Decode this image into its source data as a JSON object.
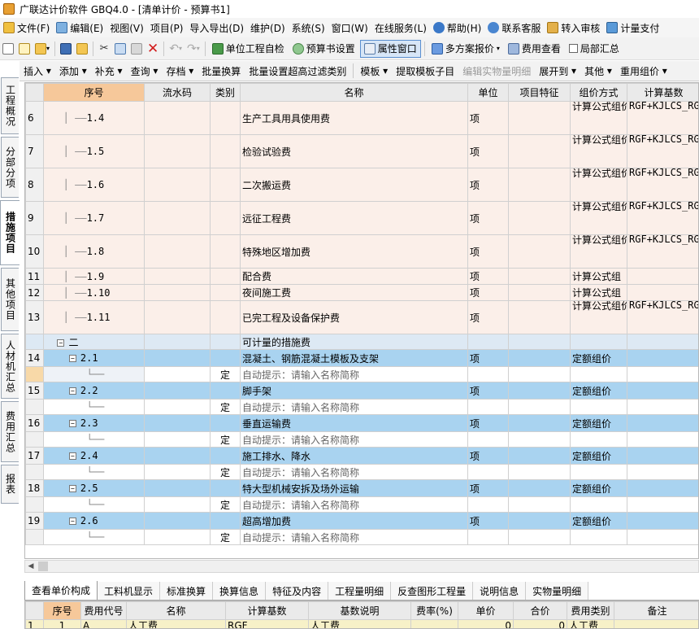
{
  "window": {
    "title": "广联达计价软件 GBQ4.0 - [清单计价 - 预算书1]"
  },
  "menu": [
    {
      "label": "文件(F)",
      "icon": "file-menu-icon"
    },
    {
      "label": "编辑(E)",
      "icon": "edit-menu-icon"
    },
    {
      "label": "视图(V)"
    },
    {
      "label": "项目(P)"
    },
    {
      "label": "导入导出(D)"
    },
    {
      "label": "维护(D)"
    },
    {
      "label": "系统(S)"
    },
    {
      "label": "窗口(W)"
    },
    {
      "label": "在线服务(L)"
    },
    {
      "label": "帮助(H)",
      "icon": "help-icon"
    },
    {
      "label": "联系客服",
      "icon": "customer-service-icon"
    },
    {
      "label": "转入审核",
      "icon": "transfer-audit-icon"
    },
    {
      "label": "计量支付",
      "icon": "measurement-payment-icon"
    }
  ],
  "toolbar1": {
    "self_check": "单位工程自检",
    "budget_settings": "预算书设置",
    "property_window": "属性窗口",
    "multi_quote": "多方案报价",
    "cost_view": "费用查看",
    "partial_summary": "局部汇总"
  },
  "toolbar2": [
    {
      "label": "插入",
      "dropdown": true
    },
    {
      "label": "添加",
      "dropdown": true
    },
    {
      "label": "补充",
      "dropdown": true
    },
    {
      "label": "查询",
      "dropdown": true
    },
    {
      "label": "存档",
      "dropdown": true
    },
    {
      "label": "批量换算",
      "dropdown": false
    },
    {
      "label": "批量设置超高过滤类别",
      "dropdown": false
    },
    {
      "label": "模板",
      "dropdown": true
    },
    {
      "label": "提取模板子目",
      "dropdown": false
    },
    {
      "label": "编辑实物量明细",
      "dropdown": false,
      "disabled": true
    },
    {
      "label": "展开到",
      "dropdown": true
    },
    {
      "label": "其他",
      "dropdown": true
    },
    {
      "label": "重用组价",
      "dropdown": true
    }
  ],
  "vtabs": [
    "工程概况",
    "分部分项",
    "措施项目",
    "其他项目",
    "人材机汇总",
    "费用汇总",
    "报表"
  ],
  "grid": {
    "headers": [
      "序号",
      "流水码",
      "类别",
      "名称",
      "单位",
      "项目特征",
      "组价方式",
      "计算基数"
    ],
    "formula_text": "RGF+KJLCS_RGF+KJLCS_JXF+JXF",
    "rows": [
      {
        "rn": "6",
        "type": "measure",
        "seq": "1.4",
        "cat": "",
        "name": "生产工具用具使用费",
        "unit": "项",
        "price": "计算公式组价",
        "formula": true
      },
      {
        "rn": "7",
        "type": "measure",
        "seq": "1.5",
        "cat": "",
        "name": "检验试验费",
        "unit": "项",
        "price": "计算公式组价",
        "formula": true
      },
      {
        "rn": "8",
        "type": "measure",
        "seq": "1.6",
        "cat": "",
        "name": "二次搬运费",
        "unit": "项",
        "price": "计算公式组价",
        "formula": true
      },
      {
        "rn": "9",
        "type": "measure",
        "seq": "1.7",
        "cat": "",
        "name": "远征工程费",
        "unit": "项",
        "price": "计算公式组价",
        "formula": true
      },
      {
        "rn": "10",
        "type": "measure",
        "seq": "1.8",
        "cat": "",
        "name": "特殊地区增加费",
        "unit": "项",
        "price": "计算公式组价",
        "formula": true
      },
      {
        "rn": "11",
        "type": "measure-short",
        "seq": "1.9",
        "cat": "",
        "name": "配合费",
        "unit": "项",
        "price": "计算公式组",
        "formula": false
      },
      {
        "rn": "12",
        "type": "measure-short",
        "seq": "1.10",
        "cat": "",
        "name": "夜间施工费",
        "unit": "项",
        "price": "计算公式组",
        "formula": false
      },
      {
        "rn": "13",
        "type": "measure",
        "seq": "1.11",
        "cat": "",
        "name": "已完工程及设备保护费",
        "unit": "项",
        "price": "计算公式组价",
        "formula": true
      },
      {
        "rn": "",
        "type": "cat",
        "seq": "二",
        "cat": "",
        "name": "可计量的措施费",
        "unit": "",
        "price": "",
        "formula": false
      },
      {
        "rn": "14",
        "type": "item",
        "seq": "2.1",
        "cat": "",
        "name": "混凝土、钢筋混凝土模板及支架",
        "unit": "项",
        "price": "定额组价",
        "formula": false
      },
      {
        "rn": "",
        "type": "sub",
        "sel": true,
        "seq": "",
        "cat": "定",
        "name": "自动提示：请输入名称简称",
        "unit": "",
        "price": "",
        "formula": false
      },
      {
        "rn": "15",
        "type": "item",
        "seq": "2.2",
        "cat": "",
        "name": "脚手架",
        "unit": "项",
        "price": "定额组价",
        "formula": false
      },
      {
        "rn": "",
        "type": "sub",
        "seq": "",
        "cat": "定",
        "name": "自动提示：请输入名称简称",
        "unit": "",
        "price": "",
        "formula": false
      },
      {
        "rn": "16",
        "type": "item",
        "seq": "2.3",
        "cat": "",
        "name": "垂直运输费",
        "unit": "项",
        "price": "定额组价",
        "formula": false
      },
      {
        "rn": "",
        "type": "sub",
        "seq": "",
        "cat": "定",
        "name": "自动提示：请输入名称简称",
        "unit": "",
        "price": "",
        "formula": false
      },
      {
        "rn": "17",
        "type": "item",
        "seq": "2.4",
        "cat": "",
        "name": "施工排水、降水",
        "unit": "项",
        "price": "定额组价",
        "formula": false
      },
      {
        "rn": "",
        "type": "sub",
        "seq": "",
        "cat": "定",
        "name": "自动提示：请输入名称简称",
        "unit": "",
        "price": "",
        "formula": false
      },
      {
        "rn": "18",
        "type": "item",
        "seq": "2.5",
        "cat": "",
        "name": "特大型机械安拆及场外运输",
        "unit": "项",
        "price": "定额组价",
        "formula": false
      },
      {
        "rn": "",
        "type": "sub",
        "seq": "",
        "cat": "定",
        "name": "自动提示：请输入名称简称",
        "unit": "",
        "price": "",
        "formula": false
      },
      {
        "rn": "19",
        "type": "item",
        "seq": "2.6",
        "cat": "",
        "name": "超高增加费",
        "unit": "项",
        "price": "定额组价",
        "formula": false
      },
      {
        "rn": "",
        "type": "sub",
        "seq": "",
        "cat": "定",
        "name": "自动提示：请输入名称简称",
        "unit": "",
        "price": "",
        "formula": false
      }
    ]
  },
  "bottom_tabs": [
    "查看单价构成",
    "工料机显示",
    "标准换算",
    "换算信息",
    "特征及内容",
    "工程量明细",
    "反查图形工程量",
    "说明信息",
    "实物量明细"
  ],
  "bottom_grid": {
    "headers": [
      "序号",
      "费用代号",
      "名称",
      "计算基数",
      "基数说明",
      "费率(%)",
      "单价",
      "合价",
      "费用类别",
      "备注"
    ],
    "rows": [
      {
        "rn": "1",
        "seq": "1",
        "code": "A",
        "name": "人工费",
        "base": "RGF",
        "base_desc": "人工费",
        "rate": "",
        "price": "0",
        "total": "0",
        "type": "人工费",
        "note": ""
      }
    ]
  }
}
